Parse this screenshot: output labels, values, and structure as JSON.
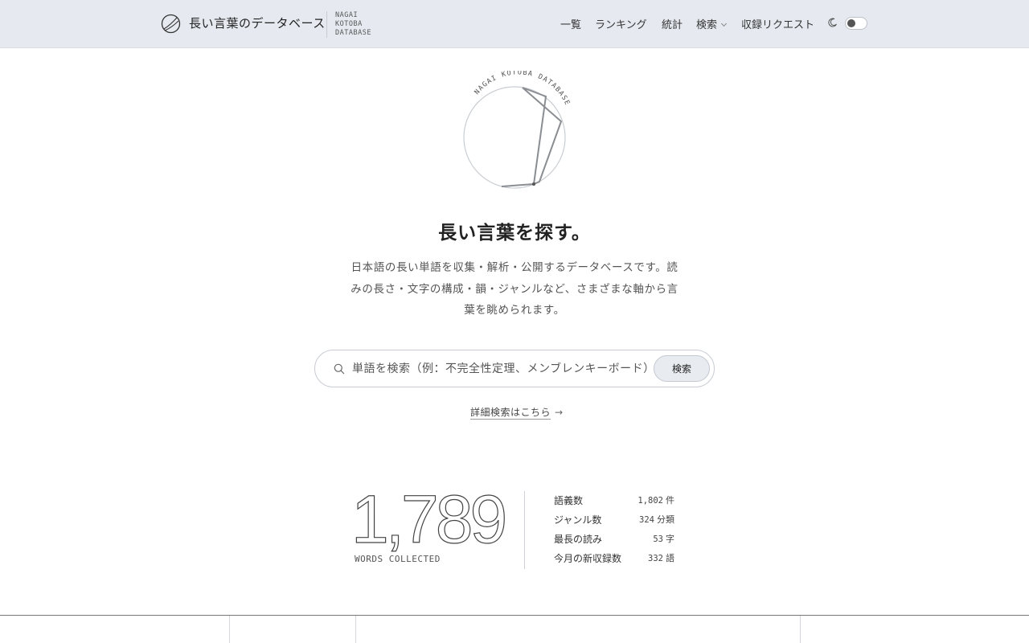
{
  "header": {
    "brand": "長い言葉のデータベース",
    "brand_sub": [
      "NAGAI",
      "KOTOBA",
      "DATABASE"
    ],
    "nav": {
      "list": "一覧",
      "ranking": "ランキング",
      "stats": "統計",
      "search": "検索",
      "request": "収録リクエスト"
    },
    "theme_toggle_on": false
  },
  "hero": {
    "emblem_text": "NAGAI KOTOBA DATABASE",
    "title": "長い言葉を探す。",
    "description": "日本語の長い単語を収集・解析・公開するデータベースです。読みの長さ・文字の構成・韻・ジャンルなど、さまざまな軸から言葉を眺められます。"
  },
  "search": {
    "placeholder": "単語を検索（例：不完全性定理、メンブレンキーボード）",
    "value": "",
    "button_label": "検索",
    "advanced_link": "詳細検索はこちら",
    "advanced_arrow": "→"
  },
  "stats": {
    "total": "1,789",
    "total_label": "WORDS COLLECTED",
    "items": [
      {
        "label": "語義数",
        "value": "1,802",
        "unit": "件"
      },
      {
        "label": "ジャンル数",
        "value": "324",
        "unit": "分類"
      },
      {
        "label": "最長の読み",
        "value": "53",
        "unit": "字"
      },
      {
        "label": "今月の新収録数",
        "value": "332",
        "unit": "語"
      }
    ]
  },
  "colors": {
    "header_bg": "#e6eaf0",
    "accent_button": "#e8ecf1",
    "text": "#333333"
  }
}
